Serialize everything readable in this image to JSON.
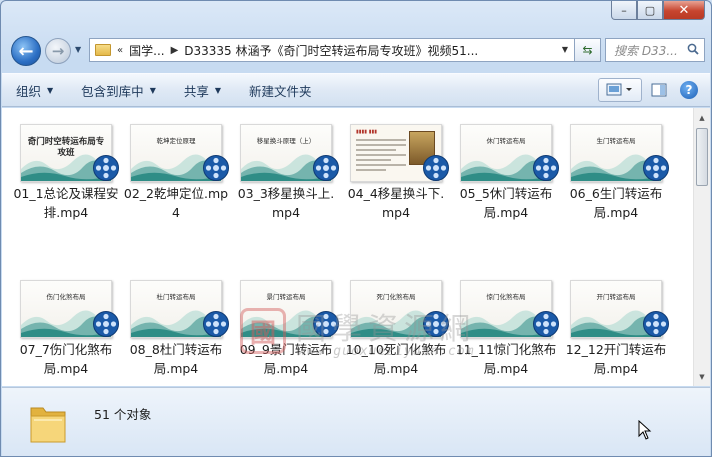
{
  "window": {
    "minimize_glyph": "–",
    "maximize_glyph": "▢",
    "close_glyph": "✕"
  },
  "address": {
    "overflow": "«",
    "crumb1": "国学...",
    "crumb2": "D33335 林涵予《奇门时空转运布局专攻班》视频51...",
    "search_placeholder": "搜索 D33..."
  },
  "toolbar": {
    "organize": "组织",
    "include_library": "包含到库中",
    "share": "共享",
    "new_folder": "新建文件夹"
  },
  "files": [
    {
      "name": "01_1总论及课程安排.mp4",
      "thumb": "奇门时空转运布局专攻班"
    },
    {
      "name": "02_2乾坤定位.mp4",
      "thumb": "乾坤定位原理"
    },
    {
      "name": "03_3移星换斗上.mp4",
      "thumb": "移星换斗原理（上）"
    },
    {
      "name": "04_4移星换斗下.mp4",
      "thumb": "移星换斗原理（下）"
    },
    {
      "name": "05_5休门转运布局.mp4",
      "thumb": "休门转运布局"
    },
    {
      "name": "06_6生门转运布局.mp4",
      "thumb": "生门转运布局"
    },
    {
      "name": "07_7伤门化煞布局.mp4",
      "thumb": "伤门化煞布局"
    },
    {
      "name": "08_8杜门转运布局.mp4",
      "thumb": "杜门转运布局"
    },
    {
      "name": "09_9景门转运布局.mp4",
      "thumb": "景门转运布局"
    },
    {
      "name": "10_10死门化煞布局.mp4",
      "thumb": "死门化煞布局"
    },
    {
      "name": "11_11惊门化煞布局.mp4",
      "thumb": "惊门化煞布局"
    },
    {
      "name": "12_12开门转运布局.mp4",
      "thumb": "开门转运布局"
    }
  ],
  "watermark": {
    "seal": "國",
    "title": "國學資源網",
    "url": "www.guoxueziyuan.com"
  },
  "status": {
    "count": "51 个对象"
  },
  "colors": {
    "accent": "#1e395b",
    "reel": "#1b5aa8",
    "mountain": "#2f8d86"
  }
}
